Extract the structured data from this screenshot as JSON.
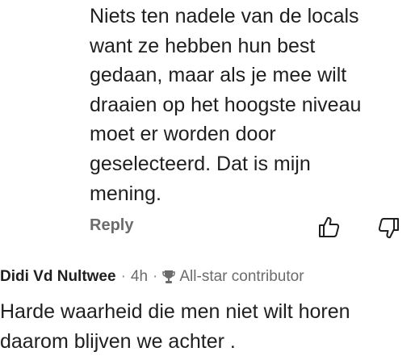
{
  "reply": {
    "lines": [
      "Niets ten nadele van de locals",
      "want ze hebben hun best",
      "gedaan, maar als je mee wilt",
      "draaien op het hoogste niveau",
      "moet er worden door",
      "geselecteerd.  Dat is mijn",
      "mening."
    ],
    "reply_label": "Reply",
    "like_icon": "thumbs-up-icon",
    "dislike_icon": "thumbs-down-icon"
  },
  "comment": {
    "author": "Didi Vd Nultwee",
    "separator": "·",
    "time": "4h",
    "badge_icon": "trophy-icon",
    "badge": "All-star contributor",
    "lines": [
      "Harde waarheid die men niet wilt horen",
      "daarom blijven we achter ."
    ]
  }
}
